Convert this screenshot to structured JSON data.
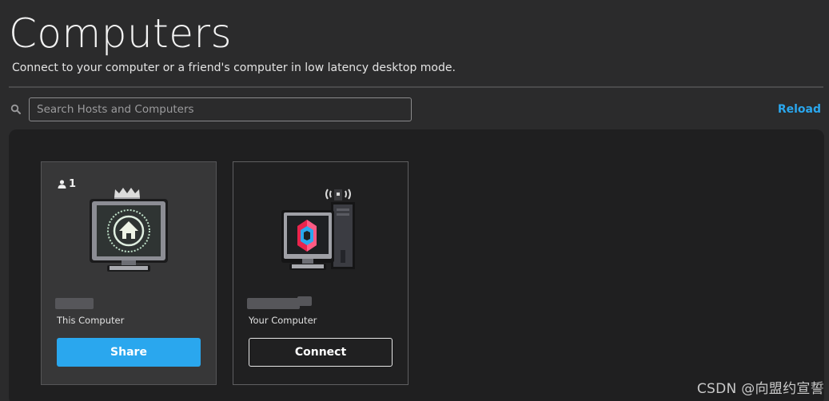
{
  "header": {
    "title": "Computers",
    "subtitle": "Connect to your computer or a friend's computer in low latency desktop mode."
  },
  "search": {
    "placeholder": "Search Hosts and Computers",
    "value": "",
    "icon": "search-icon"
  },
  "toolbar": {
    "reload_label": "Reload"
  },
  "cards": [
    {
      "user_count": "1",
      "icon": "home-monitor-icon",
      "subtitle": "This Computer",
      "button_label": "Share"
    },
    {
      "icon": "desktop-tower-icon",
      "subtitle": "Your Computer",
      "button_label": "Connect"
    }
  ],
  "watermark": "CSDN @向盟约宣誓",
  "colors": {
    "accent": "#2aa7ee",
    "background": "#2b2b2c",
    "panel": "#1f1f20"
  }
}
